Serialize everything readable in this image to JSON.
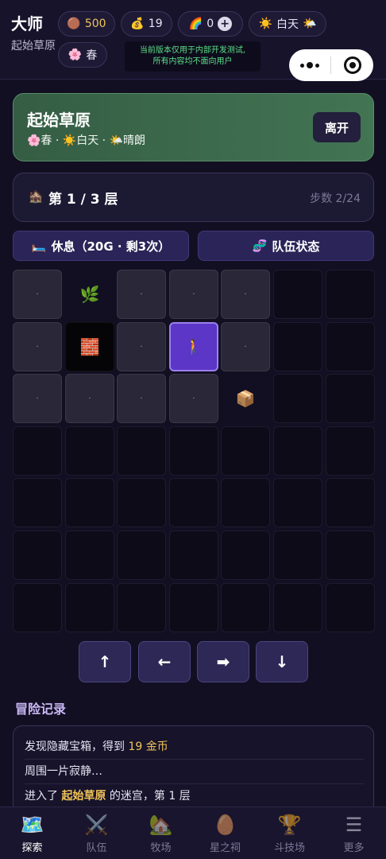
{
  "header": {
    "player_title": "大师",
    "location": "起始草原",
    "coins": {
      "icon": "🟤",
      "value": "500"
    },
    "gold": {
      "icon": "💰",
      "value": "19"
    },
    "rainbow": {
      "icon": "🌈",
      "value": "0",
      "plus": "+"
    },
    "daytime": {
      "icon": "☀️",
      "label": "白天",
      "weather_icon": "🌤️"
    },
    "season": {
      "icon": "🌸",
      "label": "春"
    },
    "notice_line1": "当前版本仅用于内部开发测试,",
    "notice_line2": "所有内容均不面向用户"
  },
  "location_card": {
    "name": "起始草原",
    "subtitle": "🌸春 · ☀️白天 · 🌤️晴朗",
    "leave_label": "离开",
    "accent_color": "#427553"
  },
  "floor": {
    "icon": "🏚️",
    "label": "第 1 / 3 层",
    "steps": "步数 2/24"
  },
  "actions": {
    "rest": {
      "icon": "🛏️",
      "label": "休息（20G · 剩3次）"
    },
    "team": {
      "icon": "🧬",
      "label": "队伍状态"
    }
  },
  "grid": {
    "rows": [
      [
        {
          "t": "seen",
          "c": "·"
        },
        {
          "t": "item",
          "c": "🌿"
        },
        {
          "t": "seen",
          "c": "·"
        },
        {
          "t": "seen",
          "c": "·"
        },
        {
          "t": "seen",
          "c": "·"
        },
        {
          "t": "fog",
          "c": ""
        },
        {
          "t": "fog",
          "c": ""
        }
      ],
      [
        {
          "t": "seen",
          "c": "·"
        },
        {
          "t": "wall",
          "c": "🧱"
        },
        {
          "t": "seen",
          "c": "·"
        },
        {
          "t": "player",
          "c": "🚶"
        },
        {
          "t": "seen",
          "c": "·"
        },
        {
          "t": "fog",
          "c": ""
        },
        {
          "t": "fog",
          "c": ""
        }
      ],
      [
        {
          "t": "seen",
          "c": "·"
        },
        {
          "t": "seen",
          "c": "·"
        },
        {
          "t": "seen",
          "c": "·"
        },
        {
          "t": "seen",
          "c": "·"
        },
        {
          "t": "item",
          "c": "📦"
        },
        {
          "t": "fog",
          "c": ""
        },
        {
          "t": "fog",
          "c": ""
        }
      ],
      [
        {
          "t": "fog",
          "c": ""
        },
        {
          "t": "fog",
          "c": ""
        },
        {
          "t": "fog",
          "c": ""
        },
        {
          "t": "fog",
          "c": ""
        },
        {
          "t": "fog",
          "c": ""
        },
        {
          "t": "fog",
          "c": ""
        },
        {
          "t": "fog",
          "c": ""
        }
      ],
      [
        {
          "t": "fog",
          "c": ""
        },
        {
          "t": "fog",
          "c": ""
        },
        {
          "t": "fog",
          "c": ""
        },
        {
          "t": "fog",
          "c": ""
        },
        {
          "t": "fog",
          "c": ""
        },
        {
          "t": "fog",
          "c": ""
        },
        {
          "t": "fog",
          "c": ""
        }
      ],
      [
        {
          "t": "fog",
          "c": ""
        },
        {
          "t": "fog",
          "c": ""
        },
        {
          "t": "fog",
          "c": ""
        },
        {
          "t": "fog",
          "c": ""
        },
        {
          "t": "fog",
          "c": ""
        },
        {
          "t": "fog",
          "c": ""
        },
        {
          "t": "fog",
          "c": ""
        }
      ],
      [
        {
          "t": "fog",
          "c": ""
        },
        {
          "t": "fog",
          "c": ""
        },
        {
          "t": "fog",
          "c": ""
        },
        {
          "t": "fog",
          "c": ""
        },
        {
          "t": "fog",
          "c": ""
        },
        {
          "t": "fog",
          "c": ""
        },
        {
          "t": "fog",
          "c": ""
        }
      ]
    ]
  },
  "dpad": {
    "up": "↑",
    "left": "←",
    "right": "➡",
    "down": "↓"
  },
  "log": {
    "title": "冒险记录",
    "line1_pre": "发现隐藏宝箱，得到 ",
    "line1_gold": "19 金币",
    "line2": "周围一片寂静…",
    "line3_pre": "进入了 ",
    "line3_place": "起始草原",
    "line3_post": " 的迷宫，第 1 层"
  },
  "nav": [
    {
      "icon": "🗺️",
      "label": "探索",
      "active": true
    },
    {
      "icon": "⚔️",
      "label": "队伍",
      "active": false
    },
    {
      "icon": "🏡",
      "label": "牧场",
      "active": false
    },
    {
      "icon": "🥚",
      "label": "星之祠",
      "active": false
    },
    {
      "icon": "🏆",
      "label": "斗技场",
      "active": false
    },
    {
      "icon": "☰",
      "label": "更多",
      "active": false
    }
  ]
}
